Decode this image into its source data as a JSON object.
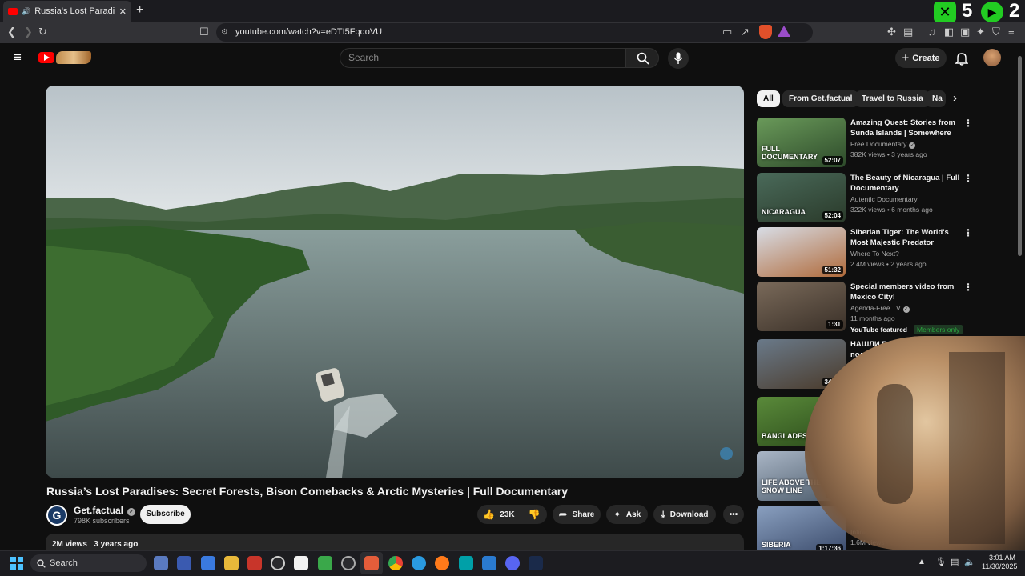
{
  "browser": {
    "tab_title": "Russia's Lost Paradises: Secre",
    "url": "youtube.com/watch?v=eDTI5FqqoVU",
    "overlay_counts": [
      "5",
      "2"
    ]
  },
  "header": {
    "search_placeholder": "Search",
    "create_label": "Create"
  },
  "video": {
    "title": "Russia’s Lost Paradises: Secret Forests, Bison Comebacks & Arctic Mysteries | Full Documentary",
    "channel": "Get.factual",
    "subscribers": "798K subscribers",
    "subscribe_label": "Subscribe",
    "likes": "23K",
    "share_label": "Share",
    "ask_label": "Ask",
    "download_label": "Download",
    "views": "2M views",
    "age": "3 years ago"
  },
  "chips": [
    "All",
    "From Get.factual",
    "Travel to Russia",
    "Na"
  ],
  "recommendations": [
    {
      "title": "Amazing Quest: Stories from Sunda Islands | Somewhere on...",
      "channel": "Free Documentary",
      "verified": true,
      "meta": "382K views • 3 years ago",
      "duration": "52:07",
      "thumb_text": "FULL DOCUMENTARY",
      "colors": [
        "#6a9a5a",
        "#2d4a2a"
      ]
    },
    {
      "title": "The Beauty of Nicaragua | Full Documentary",
      "channel": "Autentic Documentary",
      "verified": false,
      "meta": "322K views • 6 months ago",
      "duration": "52:04",
      "thumb_text": "NICARAGUA",
      "colors": [
        "#4a6a5a",
        "#2a3a2a"
      ]
    },
    {
      "title": "Siberian Tiger: The World's Most Majestic Predator",
      "channel": "Where To Next?",
      "verified": false,
      "meta": "2.4M views • 2 years ago",
      "duration": "51:32",
      "thumb_text": "",
      "colors": [
        "#d8dde6",
        "#b06a3a"
      ]
    },
    {
      "title": "Special members video from Mexico City!",
      "channel": "Agenda-Free TV",
      "verified": true,
      "meta": "11 months ago",
      "duration": "1:31",
      "thumb_text": "",
      "badge1": "YouTube featured",
      "badge2": "Members only",
      "colors": [
        "#7a6a5a",
        "#3a3028"
      ]
    },
    {
      "title": "НАШЛИ ВОЕННЫЙ БУНКЕР под КИЕВОМ !",
      "channel": "",
      "verified": false,
      "meta": "",
      "duration": "34:32",
      "thumb_text": "",
      "colors": [
        "#6a7a8a",
        "#4a3a2a"
      ]
    },
    {
      "title": "",
      "channel": "",
      "verified": false,
      "meta": "",
      "duration": "",
      "thumb_text": "BANGLADESH",
      "colors": [
        "#5a8a3a",
        "#2a4a1a"
      ]
    },
    {
      "title": "",
      "channel": "",
      "verified": false,
      "meta": "",
      "duration": "49:3",
      "thumb_text": "LIFE ABOVE THE SNOW LINE",
      "colors": [
        "#aab6c6",
        "#4a5a6a"
      ]
    },
    {
      "title": "Earth |",
      "channel": "Infinite Planet T",
      "verified": false,
      "meta": "1.6M views • 1 month ago",
      "duration": "1:17:36",
      "thumb_text": "SIBERIA",
      "colors": [
        "#8aa0c0",
        "#3a4a6a"
      ]
    }
  ],
  "taskbar": {
    "search_label": "Search",
    "time": "3:01 AM",
    "date": "11/30/2025"
  }
}
